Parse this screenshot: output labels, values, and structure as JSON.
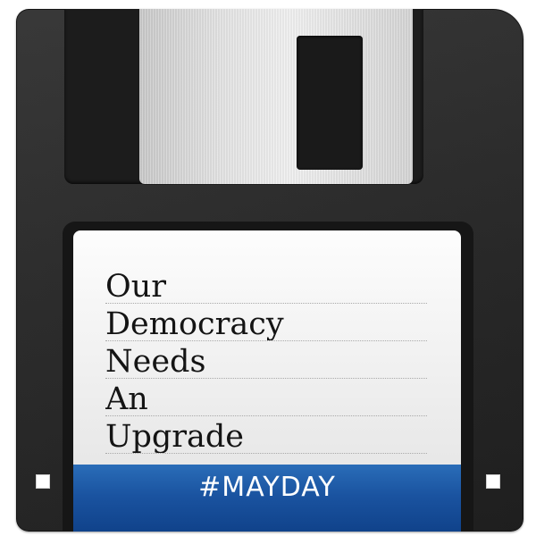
{
  "label": {
    "lines": [
      "Our",
      "Democracy",
      "Needs",
      "An",
      "Upgrade"
    ]
  },
  "hashtag": "#MAYDAY",
  "colors": {
    "disk_body": "#262626",
    "shutter": "#e0e0e0",
    "label": "#f2f2f2",
    "hashtag_bar": "#1a53a0",
    "hashtag_text": "#ffffff"
  }
}
